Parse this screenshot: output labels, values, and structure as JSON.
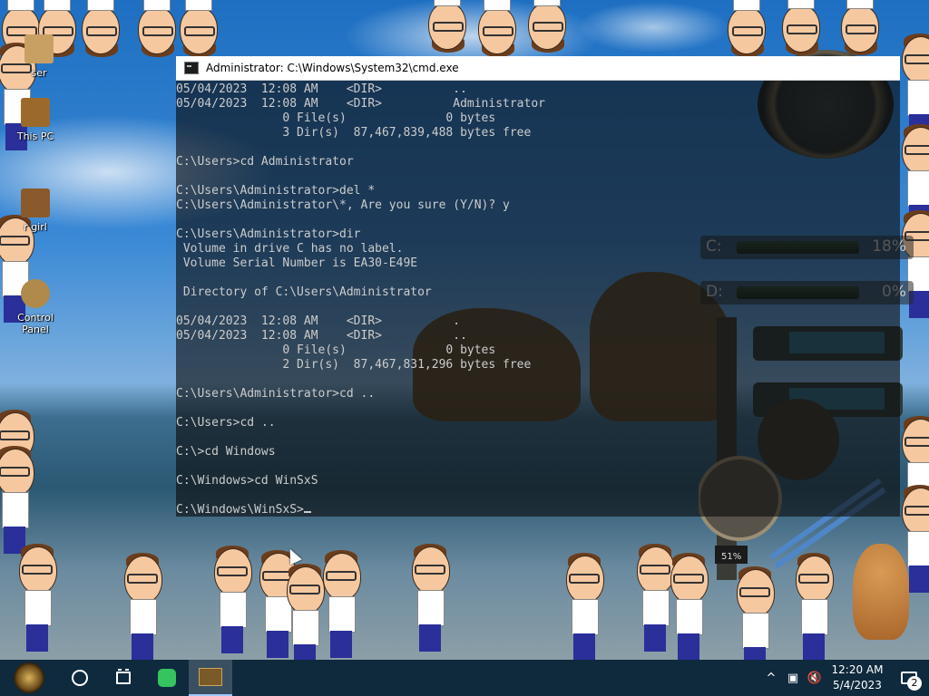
{
  "desktop": {
    "icons": [
      {
        "label": "ser",
        "icon": "user-icon"
      },
      {
        "label": "This PC",
        "icon": "computer-icon"
      },
      {
        "label": "r girl",
        "icon": "folder-icon"
      },
      {
        "label": "Control Panel",
        "icon": "control-panel-icon"
      }
    ]
  },
  "cmd_window": {
    "title": "Administrator: C:\\Windows\\System32\\cmd.exe",
    "lines": [
      "05/04/2023  12:08 AM    <DIR>          ..",
      "05/04/2023  12:08 AM    <DIR>          Administrator",
      "               0 File(s)              0 bytes",
      "               3 Dir(s)  87,467,839,488 bytes free",
      "",
      "C:\\Users>cd Administrator",
      "",
      "C:\\Users\\Administrator>del *",
      "C:\\Users\\Administrator\\*, Are you sure (Y/N)? y",
      "",
      "C:\\Users\\Administrator>dir",
      " Volume in drive C has no label.",
      " Volume Serial Number is EA30-E49E",
      "",
      " Directory of C:\\Users\\Administrator",
      "",
      "05/04/2023  12:08 AM    <DIR>          .",
      "05/04/2023  12:08 AM    <DIR>          ..",
      "               0 File(s)              0 bytes",
      "               2 Dir(s)  87,467,831,296 bytes free",
      "",
      "C:\\Users\\Administrator>cd ..",
      "",
      "C:\\Users>cd ..",
      "",
      "C:\\>cd Windows",
      "",
      "C:\\Windows>cd WinSxS",
      ""
    ],
    "prompt": "C:\\Windows\\WinSxS>"
  },
  "gadgets": {
    "drives": [
      {
        "drive": "C:",
        "percent": "18%"
      },
      {
        "drive": "D:",
        "percent": "0%"
      }
    ],
    "pressure_label": "51%"
  },
  "taskbar": {
    "start_icon": "start-orb-icon",
    "search_icon": "cortana-circle-icon",
    "taskview_icon": "task-view-icon",
    "pinned": [
      {
        "icon": "sticky-notes-icon"
      }
    ],
    "active_app": {
      "icon": "cmd-thumbnail-icon"
    },
    "tray": {
      "icons": [
        "chevron-up-icon",
        "network-icon",
        "volume-muted-icon"
      ],
      "time": "12:20 AM",
      "date": "5/4/2023",
      "notification_count": "2"
    }
  }
}
